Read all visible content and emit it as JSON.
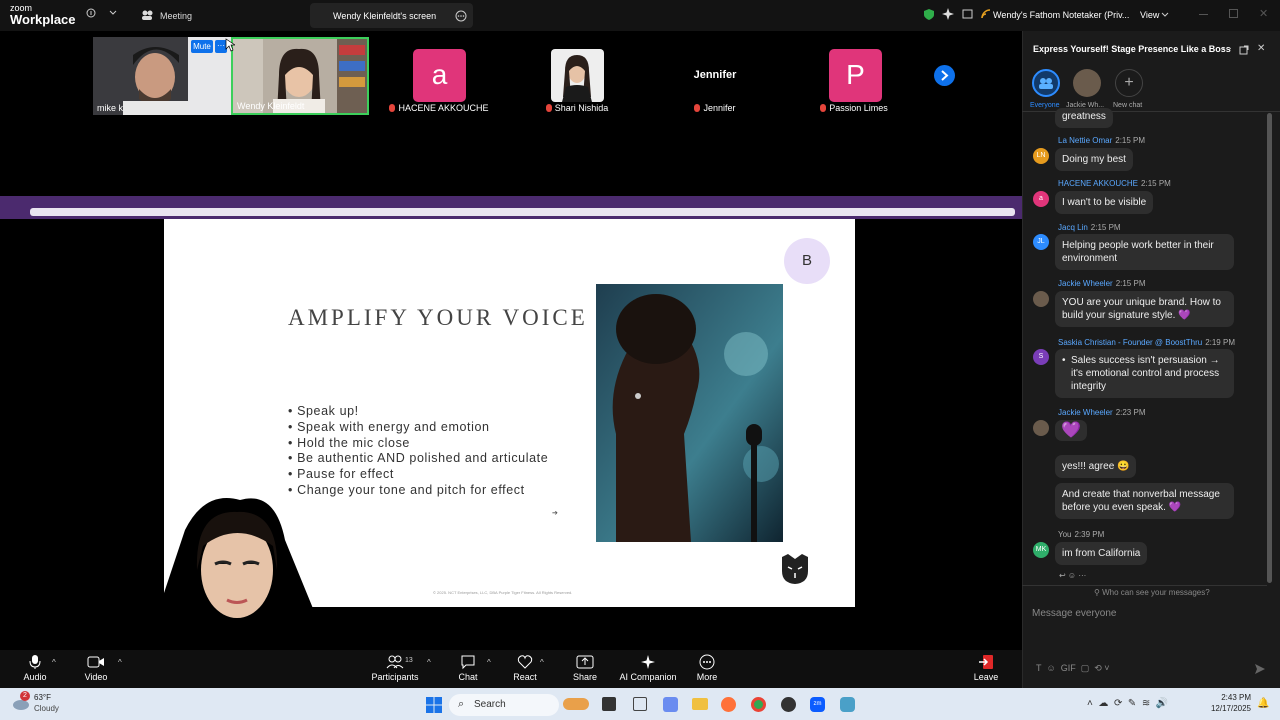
{
  "titlebar": {
    "logo_top": "zoom",
    "logo_bottom": "Workplace",
    "meeting_label": "Meeting",
    "share_tab": "Wendy Kleinfeldt's screen",
    "notetaker": "Wendy's Fathom Notetaker (Priv...",
    "view": "View"
  },
  "participants": [
    {
      "name": "mike k"
    },
    {
      "name": "Wendy Kleinfeldt",
      "mute_label": "Mute"
    },
    {
      "name": "HACENE AKKOUCHE",
      "initial": "a",
      "color": "#e0357a"
    },
    {
      "name": "Shari Nishida"
    },
    {
      "name": "Jennifer",
      "display": "Jennifer"
    },
    {
      "name": "Passion Limes",
      "initial": "P",
      "color": "#e0357a"
    }
  ],
  "slide": {
    "title": "AMPLIFY YOUR VOICE",
    "badge": "B",
    "bullets": [
      "Speak up!",
      "Speak with energy and emotion",
      "Hold the mic close",
      "Be authentic AND polished and articulate",
      "Pause for effect",
      "Change your tone and pitch for effect"
    ],
    "footer": "© 2025. NCT Enterprises, LLC, DBA Purple Tiger Fitness. All Rights Reserved.",
    "arrow": "➔"
  },
  "chat": {
    "title": "Express Yourself! Stage Presence Like a Boss",
    "tabs": [
      "Everyone",
      "Jackie Wh...",
      "New chat"
    ],
    "top_message": "greatness",
    "messages": [
      {
        "sender": "La Nettie Omar",
        "time": "2:15 PM",
        "text": "Doing my best",
        "initials": "LN",
        "color": "#e69b1e"
      },
      {
        "sender": "HACENE AKKOUCHE",
        "time": "2:15 PM",
        "text": "I wan't to be visible",
        "initials": "a",
        "color": "#e0357a"
      },
      {
        "sender": "Jacq Lin",
        "time": "2:15 PM",
        "text": "Helping people work better in their environment",
        "initials": "JL",
        "color": "#2d8cff"
      },
      {
        "sender": "Jackie Wheeler",
        "time": "2:15 PM",
        "text": "YOU are your unique brand. How to build your signature style. 💜"
      },
      {
        "sender": "Saskia Christian - Founder @ BoostThru",
        "time": "2:19 PM",
        "text": "Sales success isn't persuasion → it's emotional control and process integrity",
        "initials": "S",
        "color": "#7a3db8"
      },
      {
        "sender": "Jackie Wheeler",
        "time": "2:23 PM",
        "text": "💜",
        "text2": "yes!!! agree 😀",
        "text3": "And create that nonverbal message before you even speak. 💜"
      },
      {
        "sender": "You",
        "time": "2:39 PM",
        "text": "im from California",
        "initials": "MK",
        "color": "#2fae6a"
      }
    ],
    "who_can_see": "Who can see your messages?",
    "input_placeholder": "Message everyone"
  },
  "toolbar": {
    "audio": "Audio",
    "video": "Video",
    "participants": "Participants",
    "participant_count": "13",
    "chat": "Chat",
    "react": "React",
    "share": "Share",
    "ai": "AI Companion",
    "more": "More",
    "leave": "Leave"
  },
  "taskbar": {
    "weather_temp": "63°F",
    "weather_desc": "Cloudy",
    "badge": "2",
    "search": "Search",
    "time": "2:43 PM",
    "date": "12/17/2025"
  }
}
